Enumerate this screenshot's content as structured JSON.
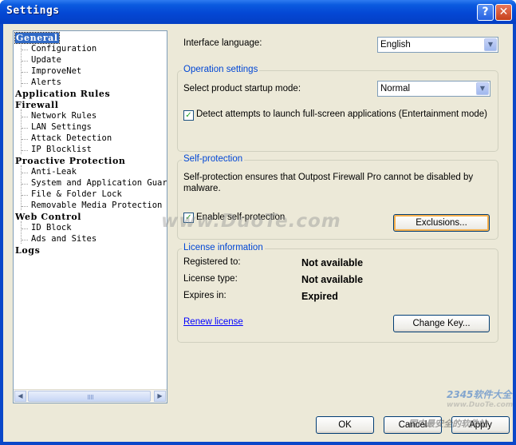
{
  "window": {
    "title": "Settings",
    "help_label": "?",
    "close_label": "✕"
  },
  "tree": {
    "items": [
      {
        "label": "General",
        "level": 0,
        "selected": true
      },
      {
        "label": "Configuration",
        "level": 1
      },
      {
        "label": "Update",
        "level": 1
      },
      {
        "label": "ImproveNet",
        "level": 1
      },
      {
        "label": "Alerts",
        "level": 1
      },
      {
        "label": "Application Rules",
        "level": 0
      },
      {
        "label": "Firewall",
        "level": 0
      },
      {
        "label": "Network Rules",
        "level": 1
      },
      {
        "label": "LAN Settings",
        "level": 1
      },
      {
        "label": "Attack Detection",
        "level": 1
      },
      {
        "label": "IP Blocklist",
        "level": 1
      },
      {
        "label": "Proactive Protection",
        "level": 0
      },
      {
        "label": "Anti-Leak",
        "level": 1
      },
      {
        "label": "System and Application Guard",
        "level": 1
      },
      {
        "label": "File & Folder Lock",
        "level": 1
      },
      {
        "label": "Removable Media Protection",
        "level": 1
      },
      {
        "label": "Web Control",
        "level": 0
      },
      {
        "label": "ID Block",
        "level": 1
      },
      {
        "label": "Ads and Sites",
        "level": 1
      },
      {
        "label": "Logs",
        "level": 0
      }
    ]
  },
  "general": {
    "interface_language_label": "Interface language:",
    "interface_language_value": "English",
    "operation": {
      "title": "Operation settings",
      "startup_mode_label": "Select product startup mode:",
      "startup_mode_value": "Normal",
      "fullscreen_checkbox_label": "Detect attempts to launch full-screen applications (Entertainment mode)",
      "fullscreen_checked": true
    },
    "self_protection": {
      "title": "Self-protection",
      "description": "Self-protection ensures that Outpost Firewall Pro cannot be disabled by malware.",
      "enable_label": "Enable self-protection",
      "enable_checked": true,
      "exclusions_button": "Exclusions..."
    },
    "license": {
      "title": "License information",
      "registered_label": "Registered to:",
      "registered_value": "Not available",
      "type_label": "License type:",
      "type_value": "Not available",
      "expires_label": "Expires in:",
      "expires_value": "Expired",
      "renew_link": "Renew license",
      "change_key_button": "Change Key..."
    }
  },
  "footer": {
    "ok": "OK",
    "cancel": "Cancel",
    "apply": "Apply"
  },
  "watermarks": {
    "center": "www.DuoTe.com",
    "corner_brand": "2345软件大全",
    "corner_url": "www.DuoTe.com",
    "corner_text": "国内最安全的软件站"
  }
}
